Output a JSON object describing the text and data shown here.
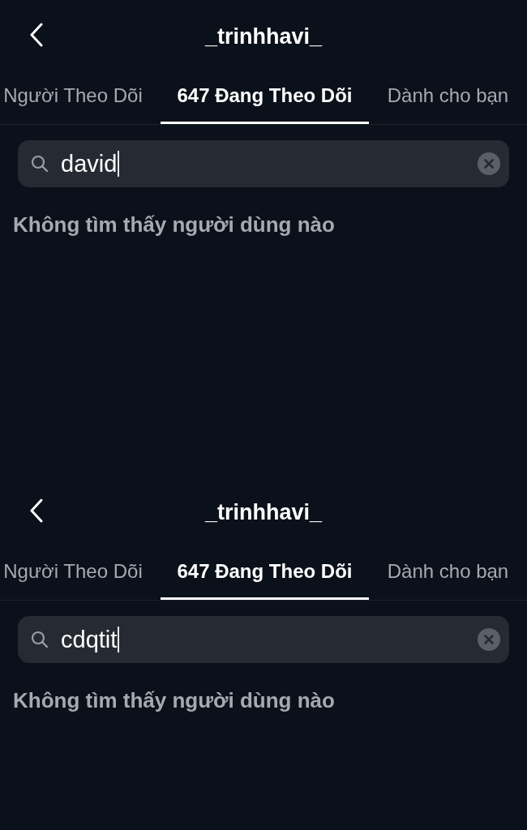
{
  "screens": [
    {
      "header": {
        "title": "_trinhhavi_"
      },
      "tabs": [
        {
          "label": "Người Theo Dõi",
          "selected": false
        },
        {
          "label": "647 Đang Theo Dõi",
          "selected": true
        },
        {
          "label": "Dành cho bạn",
          "selected": false
        }
      ],
      "search": {
        "value": "david",
        "focused": true
      },
      "message": "Không tìm thấy người dùng nào"
    },
    {
      "header": {
        "title": "_trinhhavi_"
      },
      "tabs": [
        {
          "label": "Người Theo Dõi",
          "selected": false
        },
        {
          "label": "647 Đang Theo Dõi",
          "selected": true
        },
        {
          "label": "Dành cho bạn",
          "selected": false
        }
      ],
      "search": {
        "value": "cdqtit",
        "focused": true
      },
      "message": "Không tìm thấy người dùng nào"
    }
  ]
}
